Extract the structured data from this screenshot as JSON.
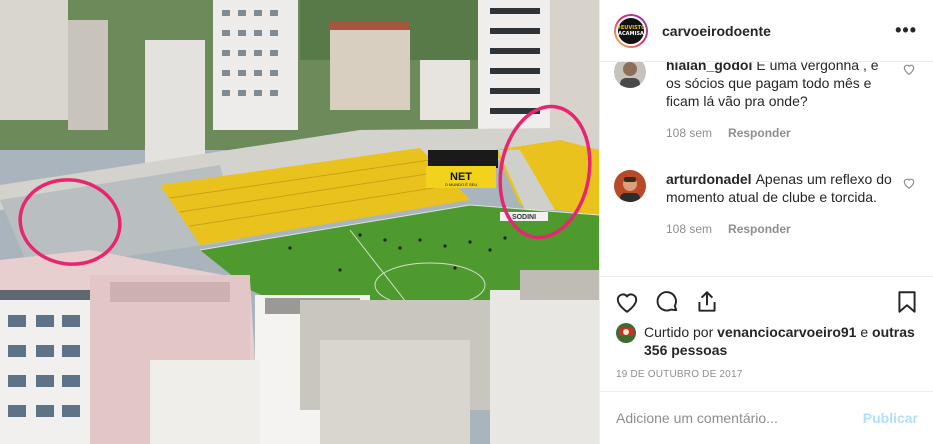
{
  "post": {
    "username": "carvoeirodoente",
    "avatar_text_top": "#EUVISTO",
    "avatar_text_bottom": "ACAMISA",
    "more_label": "•••"
  },
  "photo": {
    "scoreboard_brand": "NET",
    "scoreboard_sub": "O MUNDO É SEU",
    "ad_board": "SODINI"
  },
  "comments": [
    {
      "user": "hialan_godoi",
      "text": "É uma vergonha , e os sócios que pagam todo mês e ficam lá vão pra onde?",
      "age": "108 sem",
      "reply": "Responder"
    },
    {
      "user": "arturdonadel",
      "text": "Apenas um reflexo do momento atual de clube e torcida.",
      "age": "108 sem",
      "reply": "Responder"
    }
  ],
  "likes": {
    "prefix": "Curtido por",
    "user": "venanciocarvoeiro91",
    "and": "e",
    "others": "outras 356 pessoas"
  },
  "date": "19 DE OUTUBRO DE 2017",
  "composer": {
    "placeholder": "Adicione um comentário...",
    "publish": "Publicar"
  },
  "colors": {
    "publish_disabled": "#b2dffc",
    "annotation_circle": "#e8256f",
    "stadium_yellow": "#e9c21d",
    "pitch_green": "#4e9a2e"
  }
}
